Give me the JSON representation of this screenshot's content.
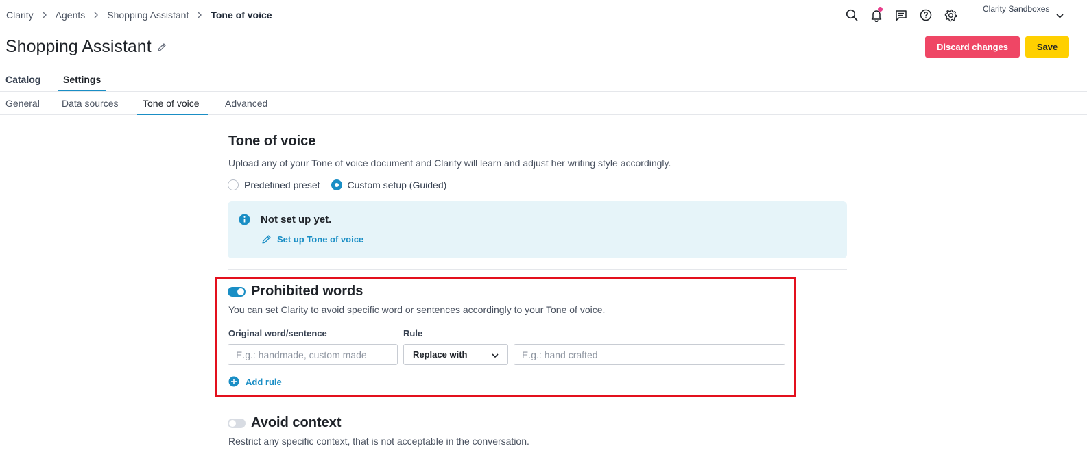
{
  "breadcrumb": [
    "Clarity",
    "Agents",
    "Shopping Assistant",
    "Tone of voice"
  ],
  "account": {
    "name": "Clarity Sandboxes"
  },
  "header": {
    "title": "Shopping Assistant"
  },
  "actions": {
    "discard_label": "Discard changes",
    "save_label": "Save"
  },
  "main_tabs": [
    {
      "label": "Catalog"
    },
    {
      "label": "Settings",
      "active": true
    }
  ],
  "sub_tabs": [
    {
      "label": "General"
    },
    {
      "label": "Data sources"
    },
    {
      "label": "Tone of voice",
      "active": true
    },
    {
      "label": "Advanced"
    }
  ],
  "tone": {
    "title": "Tone of voice",
    "description": "Upload any of your Tone of voice document and Clarity will learn and adjust her writing style accordingly.",
    "options": [
      {
        "label": "Predefined preset",
        "checked": false
      },
      {
        "label": "Custom setup (Guided)",
        "checked": true
      }
    ],
    "info": {
      "title": "Not set up yet.",
      "link": "Set up Tone of voice"
    }
  },
  "prohibited": {
    "enabled": true,
    "title": "Prohibited words",
    "description": "You can set Clarity to avoid specific word or sentences accordingly to your Tone of voice.",
    "original_label": "Original word/sentence",
    "rule_label": "Rule",
    "original_placeholder": "E.g.: handmade, custom made",
    "rule_value": "Replace with",
    "replacement_placeholder": "E.g.: hand crafted",
    "add_rule": "Add rule"
  },
  "avoid_context": {
    "enabled": false,
    "title": "Avoid context",
    "description": "Restrict any specific context, that is not acceptable in the conversation."
  },
  "colors": {
    "accent": "#1a8ec5",
    "danger": "#ef4665",
    "save": "#ffd000",
    "highlight": "#e3101d",
    "notification": "#e83e8c"
  }
}
